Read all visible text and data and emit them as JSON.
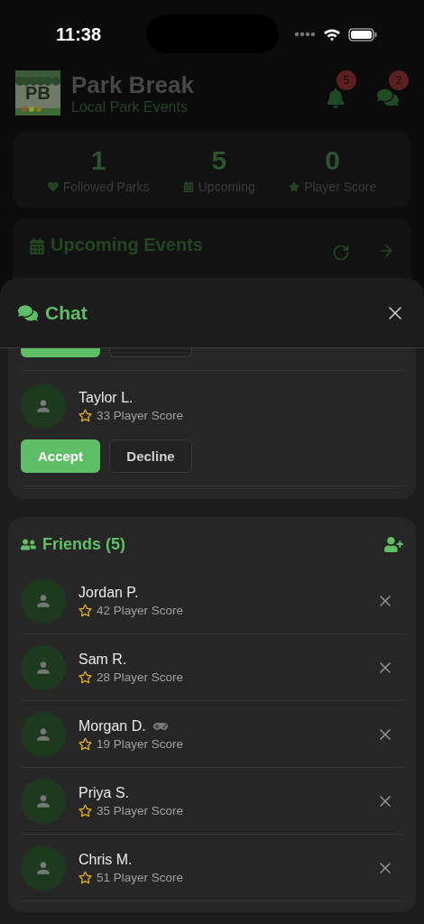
{
  "status_bar": {
    "time": "11:38"
  },
  "header": {
    "logo_text": "PB",
    "title": "Park Break",
    "subtitle": "Local Park Events",
    "notifications_badge": "5",
    "messages_badge": "2"
  },
  "stats": [
    {
      "kind": "heart",
      "value": "1",
      "label": "Followed Parks"
    },
    {
      "kind": "calendar",
      "value": "5",
      "label": "Upcoming"
    },
    {
      "kind": "star",
      "value": "0",
      "label": "Player Score"
    }
  ],
  "events_card": {
    "title": "Upcoming Events"
  },
  "chat_sheet": {
    "title": "Chat",
    "requests": [
      {
        "kind": "cut_off"
      },
      {
        "kind": "request",
        "name": "Taylor L.",
        "score": "33 Player Score",
        "accept": "Accept",
        "decline": "Decline"
      }
    ],
    "friends": {
      "title": "Friends (5)",
      "items": [
        {
          "name": "Jordan P.",
          "score": "42 Player Score",
          "in_game": false
        },
        {
          "name": "Sam R.",
          "score": "28 Player Score",
          "in_game": false
        },
        {
          "name": "Morgan D.",
          "score": "19 Player Score",
          "in_game": true
        },
        {
          "name": "Priya S.",
          "score": "35 Player Score",
          "in_game": false
        },
        {
          "name": "Chris M.",
          "score": "51 Player Score",
          "in_game": false
        }
      ]
    }
  }
}
